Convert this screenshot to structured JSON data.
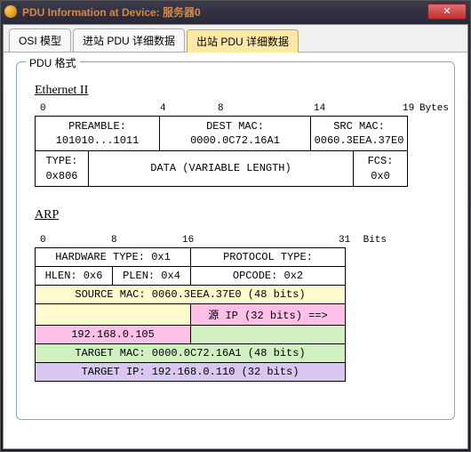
{
  "window": {
    "title": "PDU Information at Device: 服务器0",
    "close": "✕"
  },
  "tabs": {
    "osi": "OSI 模型",
    "inbound": "进站 PDU 详细数据",
    "outbound": "出站 PDU 详细数据"
  },
  "group": {
    "label": "PDU 格式"
  },
  "ethernet": {
    "title": "Ethernet II",
    "ruler": {
      "t0": "0",
      "t4": "4",
      "t8": "8",
      "t14": "14",
      "t19": "19",
      "unit": "Bytes"
    },
    "preamble_label": "PREAMBLE:",
    "preamble_value": "101010...1011",
    "destmac_label": "DEST MAC:",
    "destmac_value": "0000.0C72.16A1",
    "srcmac_label": "SRC MAC:",
    "srcmac_value": "0060.3EEA.37E0",
    "type_label": "TYPE:",
    "type_value": "0x806",
    "data_label": "DATA (VARIABLE LENGTH)",
    "fcs_label": "FCS:",
    "fcs_value": "0x0"
  },
  "arp": {
    "title": "ARP",
    "ruler": {
      "t0": "0",
      "t8": "8",
      "t16": "16",
      "t31": "31",
      "unit": "Bits"
    },
    "hwtype": "HARDWARE TYPE: 0x1",
    "ptype": "PROTOCOL TYPE:",
    "hlen": "HLEN: 0x6",
    "plen": "PLEN: 0x4",
    "opcode": "OPCODE: 0x2",
    "srcmac": "SOURCE MAC: 0060.3EEA.37E0 (48 bits)",
    "srcip_label": "源 IP (32 bits) ==>",
    "srcip_value": "192.168.0.105",
    "tgtmac": "TARGET MAC: 0000.0C72.16A1 (48 bits)",
    "tgtip": "TARGET IP: 192.168.0.110 (32 bits)"
  }
}
